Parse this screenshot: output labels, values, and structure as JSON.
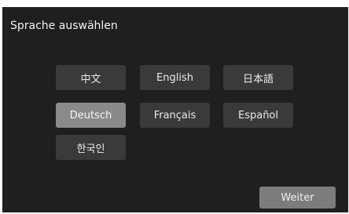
{
  "title": "Sprache auswählen",
  "languages": [
    {
      "label": "中文"
    },
    {
      "label": "English"
    },
    {
      "label": "日本語"
    },
    {
      "label": "Deutsch",
      "selected": true
    },
    {
      "label": "Français"
    },
    {
      "label": "Español"
    },
    {
      "label": "한국인"
    }
  ],
  "next_button": "Weiter",
  "colors": {
    "background": "#1f1f1f",
    "button": "#3a3a3a",
    "button_selected": "#8a8a8a",
    "next_button": "#7c7c7c"
  }
}
